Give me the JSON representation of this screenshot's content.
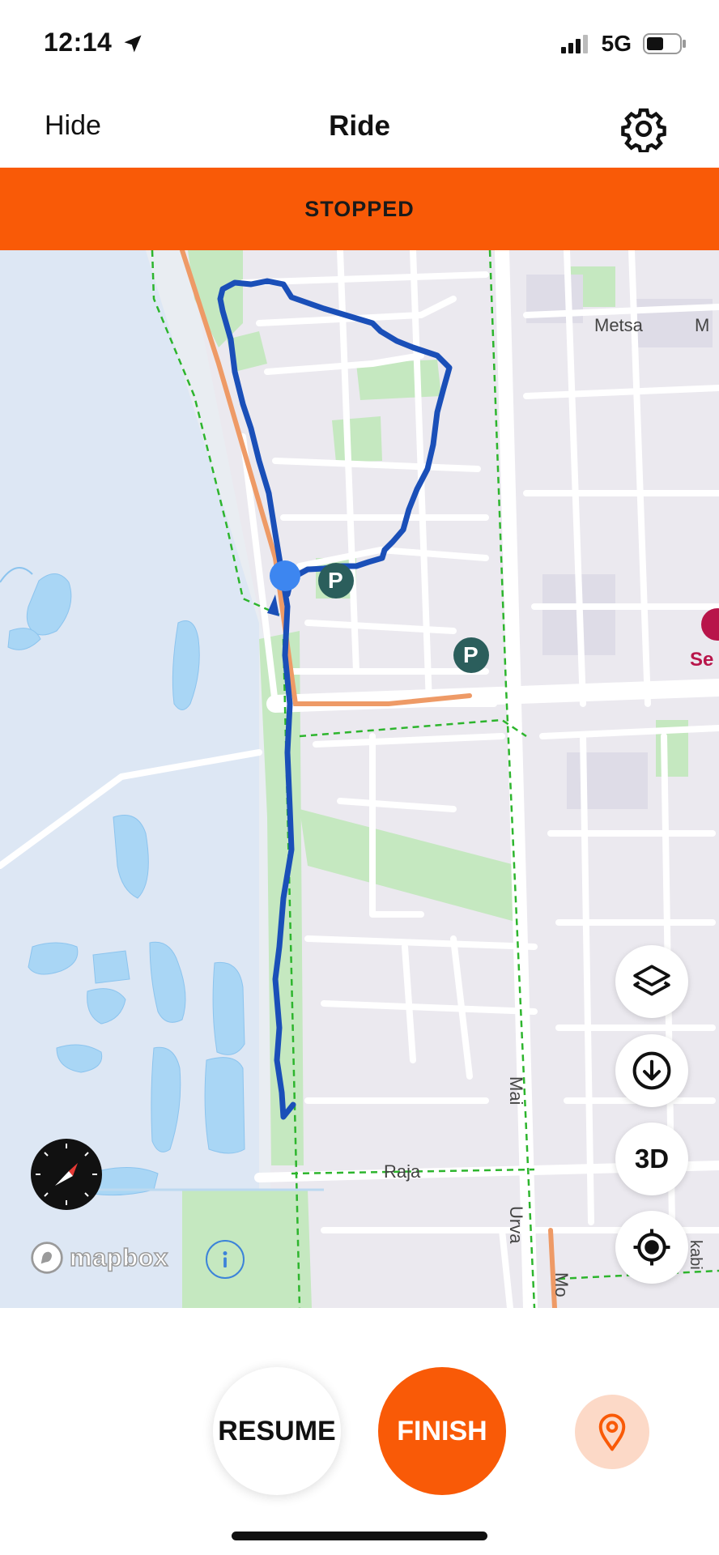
{
  "status_bar": {
    "time": "12:14",
    "network": "5G",
    "icons": [
      "location-arrow-icon",
      "signal-icon",
      "battery-icon"
    ]
  },
  "header": {
    "hide_label": "Hide",
    "title": "Ride",
    "settings_icon": "gear-icon"
  },
  "banner": {
    "status": "STOPPED",
    "color": "#f95a07"
  },
  "map": {
    "streets": [
      "Metsa",
      "M",
      "Mai",
      "Raja",
      "Urva",
      "Se",
      "Mo",
      "kabi"
    ],
    "attribution": "mapbox",
    "parking_label": "P",
    "controls": {
      "layers_icon": "layers-icon",
      "download_icon": "download-icon",
      "three_d": "3D",
      "locate_icon": "crosshair-icon",
      "compass_icon": "compass-icon",
      "info_icon": "info-icon"
    },
    "route_color": "#1a4fb8",
    "location_color": "#3d86f0"
  },
  "actions": {
    "resume": "RESUME",
    "finish": "FINISH",
    "pin_icon": "map-pin-icon",
    "accent": "#f95a07"
  }
}
